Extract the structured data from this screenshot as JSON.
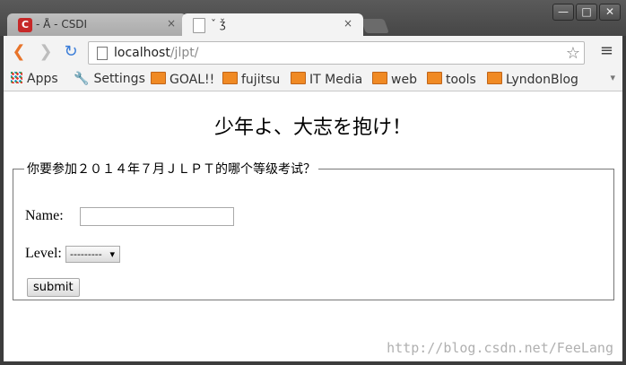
{
  "tabs": [
    {
      "title": "- Å                - CSDI",
      "close": "×"
    },
    {
      "title": "ˇ              ǯ",
      "close": "×"
    }
  ],
  "window_controls": {
    "minimize": "—",
    "maximize": "□",
    "close": "✕"
  },
  "toolbar": {
    "back": "❮",
    "forward": "❯",
    "reload": "↻",
    "url_host": "localhost",
    "url_path": "/jlpt/",
    "star": "☆",
    "menu": "≡"
  },
  "bookmarks": [
    "Apps",
    "Settings",
    "GOAL!!",
    "fujitsu",
    "IT Media",
    "web",
    "tools",
    "LyndonBlog"
  ],
  "bookmarks_more": "▾",
  "page": {
    "headline": "少年よ、大志を抱け！",
    "legend": "你要参加２０１４年７月ＪＬＰＴ的哪个等级考试？",
    "name_label": "Name:",
    "name_value": "",
    "level_label": "Level:",
    "level_selected": "---------",
    "level_arrow": "▾",
    "submit_label": "submit",
    "watermark": "http://blog.csdn.net/FeeLang"
  }
}
